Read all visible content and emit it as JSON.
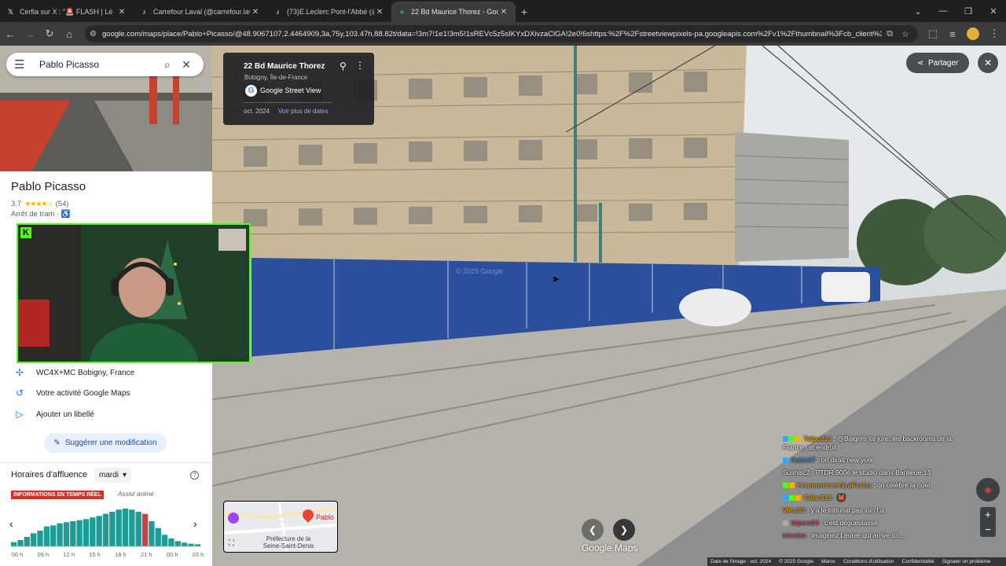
{
  "browser": {
    "tabs": [
      {
        "icon": "x-logo-icon",
        "title": "Cerfia sur X : \"🚨 FLASH | Lé",
        "active": false
      },
      {
        "icon": "tiktok-icon",
        "title": "Carrefour Laval (@carrefour.lav",
        "active": false
      },
      {
        "icon": "tiktok-icon",
        "title": "(73)E.Leclerc Pont-l'Abbé (@lec",
        "active": false
      },
      {
        "icon": "maps-pin-icon",
        "title": "22 Bd Maurice Thorez - Google",
        "active": true
      }
    ],
    "url": "google.com/maps/place/Pablo+Picasso/@48.9067107,2.4464909,3a,75y,103.47h,88.82t/data=!3m7!1e1!3m5!1sREVc5z5sIKYxDXivzaClGA!2e0!6shttps:%2F%2Fstreetviewpixels-pa.googleapis.com%2Fv1%2Fthumbnail%3Fcb_client%3Dmaps_..."
  },
  "panel": {
    "search_text": "Pablo Picasso",
    "place_name": "Pablo Picasso",
    "rating": "3,7",
    "stars": "★★★★☆",
    "reviews": "(54)",
    "category": "Arrêt de tram · ♿",
    "plus_code": "WC4X+MC Bobigny, France",
    "activity": "Votre activité Google Maps",
    "add_label": "Ajouter un libellé",
    "suggest": "Suggérer une modification",
    "busy_title": "Horaires d'affluence",
    "busy_day": "mardi",
    "live_badge": "INFORMATIONS EN TEMPS RÉEL",
    "live_note": "Assez animé",
    "hours": [
      "06 h",
      "09 h",
      "12 h",
      "15 h",
      "18 h",
      "21 h",
      "00 h",
      "03 h"
    ],
    "busyness": [
      8,
      12,
      18,
      25,
      30,
      38,
      40,
      44,
      46,
      48,
      50,
      52,
      55,
      58,
      62,
      66,
      70,
      72,
      70,
      66,
      62,
      48,
      35,
      22,
      15,
      10,
      7,
      5,
      4
    ],
    "live_index": 20
  },
  "streetview": {
    "address": "22 Bd Maurice Thorez",
    "locality": "Bobigny, Île-de-France",
    "source": "Google Street View",
    "date": "oct. 2024",
    "more_dates": "Voir plus de dates",
    "share": "Partager",
    "watermark": "© 2025 Google",
    "minimap_place": "Pablo",
    "minimap_label": "Préfecture de la Seine-Saint-Denis",
    "brand": "Google Maps",
    "footer": [
      "Date de l'image : oct. 2024",
      "© 2025 Google",
      "Maroc",
      "Conditions d'utilisation",
      "Confidentialité",
      "Signaler un problème"
    ]
  },
  "chat": [
    {
      "user": "Tallac313",
      "color": "#ffb100",
      "text": "@Balgrim jte jure, les backrooms de la France cet endroit"
    },
    {
      "user": "Kaido67",
      "color": "#35a7ff",
      "text": "on dirait new york"
    },
    {
      "user": "Sushisc2",
      "color": "#ffffff",
      "text": "PTDR 900e le studio dans Banlieue 13"
    },
    {
      "user": "HeureusementIlyaFindus",
      "color": "#ffb100",
      "text": "on célèbre la noel"
    },
    {
      "user": "Tallac313",
      "color": "#ffb100",
      "text": "👹"
    },
    {
      "user": "Viirtu92",
      "color": "#ffb100",
      "text": "y'a le tribunal pas loin l a"
    },
    {
      "user": "felpera94",
      "color": "#ff4d6d",
      "text": "c'est degueulasse"
    },
    {
      "user": "tchmktn",
      "color": "#ff4d6d",
      "text": "imaginez Léonie qui arrive ici ..."
    }
  ],
  "colors": {
    "accent": "#1a73e8",
    "kick": "#53fc18",
    "live": "#d93025",
    "bars": "#1e9c96"
  }
}
